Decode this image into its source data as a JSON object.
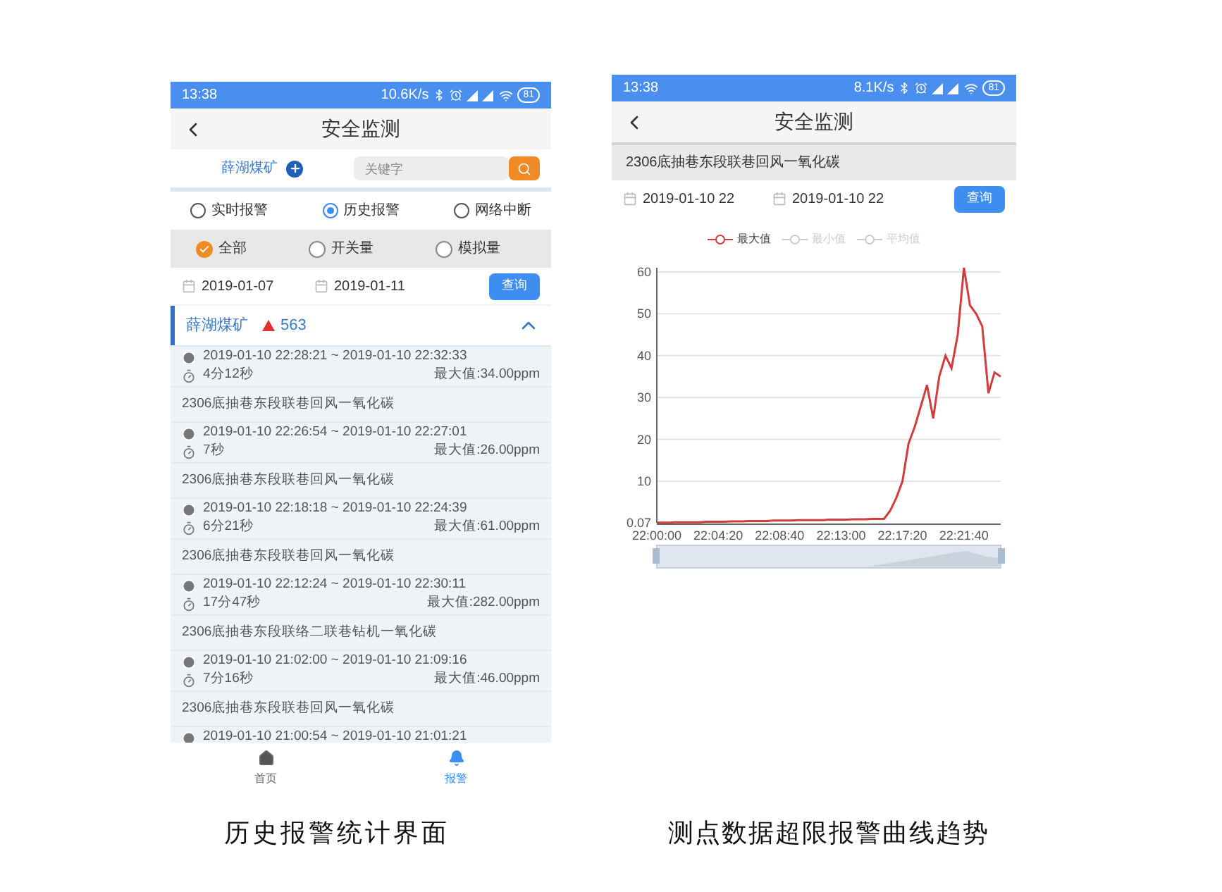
{
  "left_screen": {
    "status_bar": {
      "time": "13:38",
      "speed": "10.6K/s",
      "battery": "81"
    },
    "title": "安全监测",
    "mine_label": "薛湖煤矿",
    "search": {
      "placeholder": "关键字"
    },
    "alarm_tabs": [
      {
        "label": "实时报警",
        "selected": false
      },
      {
        "label": "历史报警",
        "selected": true
      },
      {
        "label": "网络中断",
        "selected": false
      }
    ],
    "type_filters": [
      {
        "label": "全部",
        "selected": true
      },
      {
        "label": "开关量",
        "selected": false
      },
      {
        "label": "模拟量",
        "selected": false
      }
    ],
    "date_from": "2019-01-07",
    "date_to": "2019-01-11",
    "query_button": "查询",
    "group": {
      "name": "薛湖煤矿",
      "count": "563",
      "expanded": true
    },
    "records": [
      {
        "time_range": "2019-01-10 22:28:21 ~ 2019-01-10 22:32:33",
        "duration": "4分12秒",
        "max": "最大值:34.00ppm"
      },
      {
        "name": "2306底抽巷东段联巷回风一氧化碳",
        "time_range": "2019-01-10 22:26:54 ~ 2019-01-10 22:27:01",
        "duration": "7秒",
        "max": "最大值:26.00ppm"
      },
      {
        "name": "2306底抽巷东段联巷回风一氧化碳",
        "time_range": "2019-01-10 22:18:18 ~ 2019-01-10 22:24:39",
        "duration": "6分21秒",
        "max": "最大值:61.00ppm"
      },
      {
        "name": "2306底抽巷东段联巷回风一氧化碳",
        "time_range": "2019-01-10 22:12:24 ~ 2019-01-10 22:30:11",
        "duration": "17分47秒",
        "max": "最大值:282.00ppm"
      },
      {
        "name": "2306底抽巷东段联络二联巷钻机一氧化碳",
        "time_range": "2019-01-10 21:02:00 ~ 2019-01-10 21:09:16",
        "duration": "7分16秒",
        "max": "最大值:46.00ppm"
      },
      {
        "name": "2306底抽巷东段联巷回风一氧化碳",
        "time_range": "2019-01-10 21:00:54 ~ 2019-01-10 21:01:21"
      }
    ],
    "bottom_nav": [
      {
        "label": "首页",
        "kind": "home",
        "selected": false
      },
      {
        "label": "报警",
        "kind": "bell",
        "selected": true
      }
    ]
  },
  "left_caption": "历史报警统计界面",
  "right_screen": {
    "status_bar": {
      "time": "13:38",
      "speed": "8.1K/s",
      "battery": "81"
    },
    "title": "安全监测",
    "sensor_name": "2306底抽巷东段联巷回风一氧化碳",
    "date_from": "2019-01-10 22",
    "date_to": "2019-01-10 22",
    "query_button": "查询",
    "legend": [
      {
        "on": true
      },
      {
        "on": false
      },
      {
        "on": false
      }
    ],
    "chart_data": {
      "type": "line",
      "grid": true,
      "categories": [
        "22:00:00",
        null,
        null,
        null,
        null,
        null,
        null,
        null,
        null,
        null,
        "22:04:20",
        null,
        null,
        null,
        null,
        null,
        null,
        null,
        null,
        null,
        "22:08:40",
        null,
        null,
        null,
        null,
        null,
        null,
        null,
        null,
        null,
        "22:13:00",
        null,
        null,
        null,
        null,
        null,
        null,
        null,
        null,
        null,
        "22:17:20",
        null,
        null,
        null,
        null,
        null,
        null,
        null,
        null,
        null,
        "22:21:40",
        null,
        null,
        null,
        null,
        null,
        null
      ],
      "series": [
        {
          "name": "最大值",
          "color": "#d23c3c",
          "values": [
            0.1,
            0.1,
            0.1,
            0.2,
            0.2,
            0.2,
            0.2,
            0.2,
            0.3,
            0.3,
            0.3,
            0.3,
            0.4,
            0.4,
            0.4,
            0.5,
            0.5,
            0.5,
            0.5,
            0.6,
            0.6,
            0.6,
            0.6,
            0.7,
            0.7,
            0.7,
            0.7,
            0.7,
            0.8,
            0.8,
            0.8,
            0.8,
            0.9,
            0.9,
            0.9,
            1,
            1,
            1,
            3,
            6,
            10,
            19,
            23,
            28,
            33,
            25,
            35,
            40,
            37,
            45,
            61,
            52,
            50,
            47,
            31,
            36,
            35
          ]
        },
        {
          "name": "最小值",
          "values": [
            null,
            null,
            null,
            null,
            null,
            null,
            null,
            null,
            null,
            null,
            null,
            null,
            null,
            null,
            null,
            null,
            null,
            null,
            null,
            null,
            null,
            null,
            null,
            null,
            null,
            null,
            null,
            null,
            null,
            null,
            null,
            null,
            null,
            null,
            null,
            null,
            null,
            null,
            null,
            null,
            null,
            null,
            null,
            null,
            null,
            null,
            null,
            null,
            null,
            null,
            null,
            null,
            null,
            null,
            null,
            null,
            null
          ]
        },
        {
          "name": "平均值",
          "values": [
            null,
            null,
            null,
            null,
            null,
            null,
            null,
            null,
            null,
            null,
            null,
            null,
            null,
            null,
            null,
            null,
            null,
            null,
            null,
            null,
            null,
            null,
            null,
            null,
            null,
            null,
            null,
            null,
            null,
            null,
            null,
            null,
            null,
            null,
            null,
            null,
            null,
            null,
            null,
            null,
            null,
            null,
            null,
            null,
            null,
            null,
            null,
            null,
            null,
            null,
            null,
            null,
            null,
            null,
            null,
            null,
            null
          ]
        }
      ],
      "ylim": [
        0.07,
        61
      ],
      "yticks": [
        0.07,
        10,
        20,
        30,
        40,
        50,
        60
      ]
    }
  },
  "right_caption": "测点数据超限报警曲线趋势"
}
